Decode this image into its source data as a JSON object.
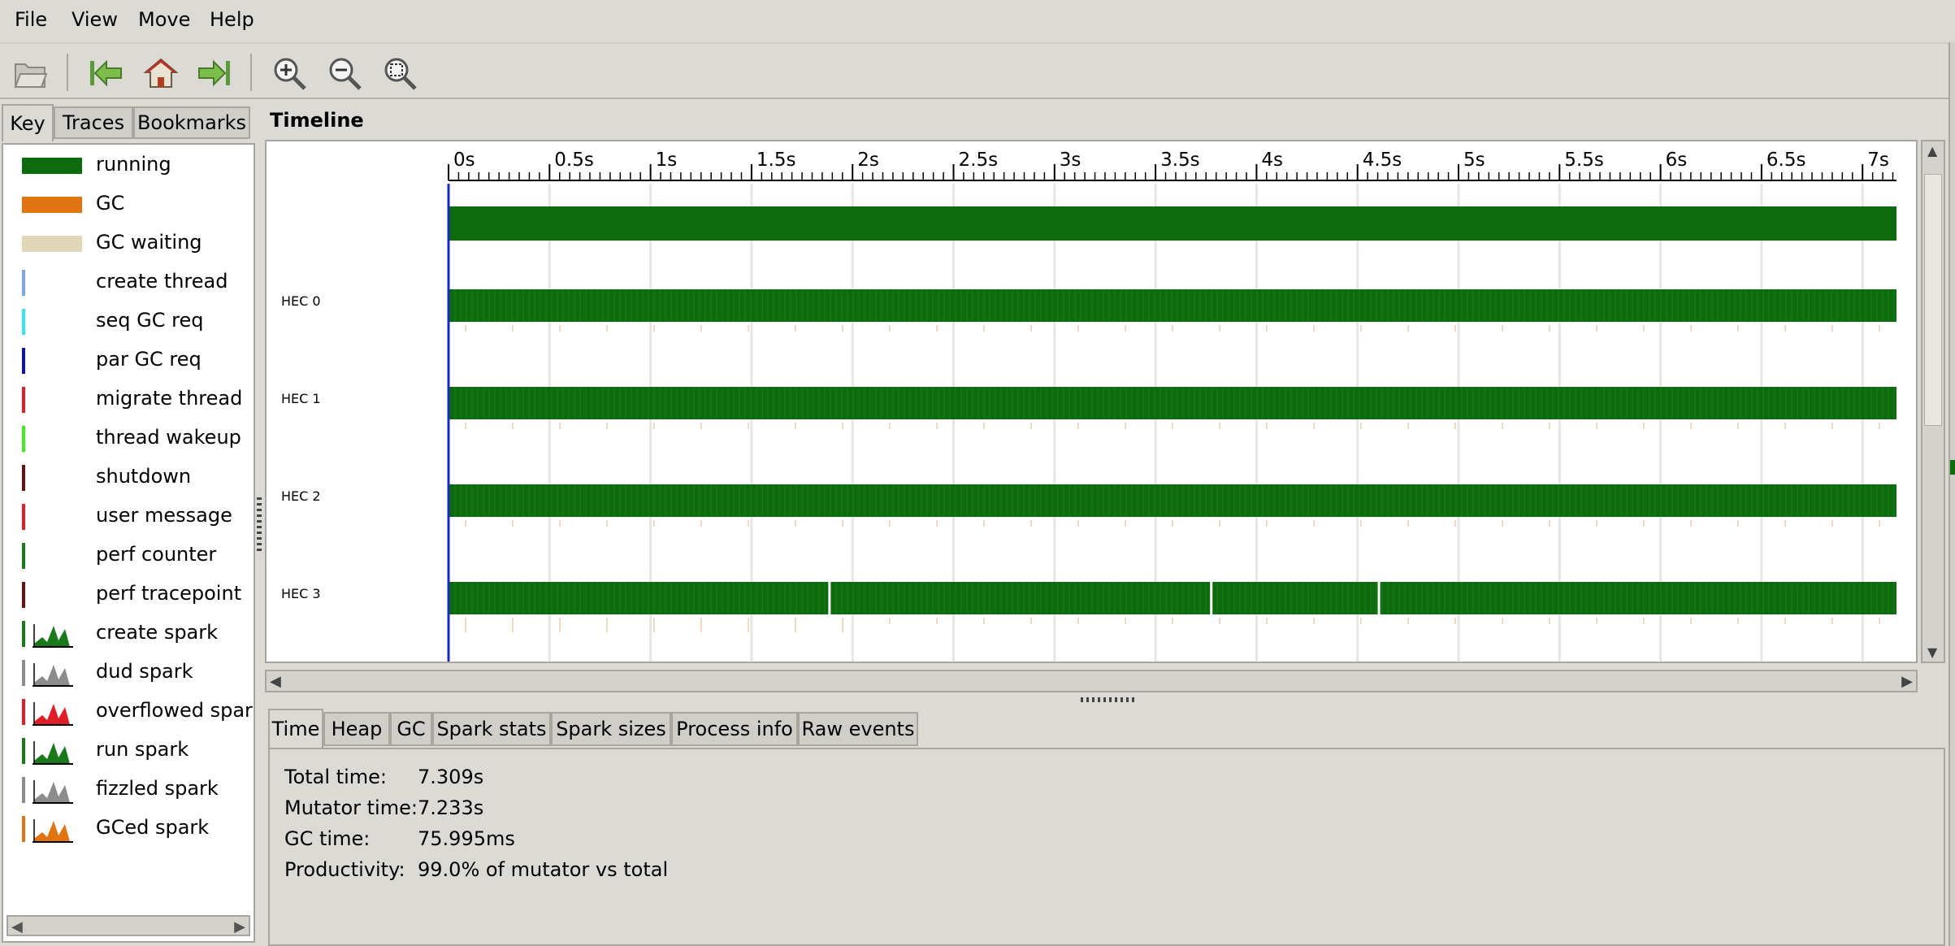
{
  "menu": [
    "File",
    "View",
    "Move",
    "Help"
  ],
  "toolbar": {
    "icons": [
      "open-icon",
      "jump-start-icon",
      "home-icon",
      "jump-end-icon",
      "zoom-in-icon",
      "zoom-out-icon",
      "zoom-fit-icon"
    ]
  },
  "left_tabs": [
    "Key",
    "Traces",
    "Bookmarks"
  ],
  "key": [
    {
      "label": "running",
      "color": "#0c6b0c",
      "kind": "bar"
    },
    {
      "label": "GC",
      "color": "#e07410",
      "kind": "bar"
    },
    {
      "label": "GC waiting",
      "color": "#e0d6b8",
      "kind": "bar"
    },
    {
      "label": "create thread",
      "color": "#7aa6f0",
      "kind": "line"
    },
    {
      "label": "seq GC req",
      "color": "#35e8f0",
      "kind": "line"
    },
    {
      "label": "par GC req",
      "color": "#0a13b8",
      "kind": "line"
    },
    {
      "label": "migrate thread",
      "color": "#e01e28",
      "kind": "line"
    },
    {
      "label": "thread wakeup",
      "color": "#3cf020",
      "kind": "line"
    },
    {
      "label": "shutdown",
      "color": "#6b1010",
      "kind": "line"
    },
    {
      "label": "user message",
      "color": "#e01e28",
      "kind": "line"
    },
    {
      "label": "perf counter",
      "color": "#1a7a1a",
      "kind": "line"
    },
    {
      "label": "perf tracepoint",
      "color": "#6b1010",
      "kind": "line"
    },
    {
      "label": "create spark",
      "color": "#1a7a1a",
      "kind": "spark"
    },
    {
      "label": "dud spark",
      "color": "#8c8c8c",
      "kind": "spark"
    },
    {
      "label": "overflowed spark",
      "color": "#e01e28",
      "kind": "spark"
    },
    {
      "label": "run spark",
      "color": "#1a7a1a",
      "kind": "spark"
    },
    {
      "label": "fizzled spark",
      "color": "#8c8c8c",
      "kind": "spark"
    },
    {
      "label": "GCed spark",
      "color": "#e07410",
      "kind": "spark"
    }
  ],
  "timeline": {
    "title": "Timeline",
    "ticks": [
      "0s",
      "0.5s",
      "1s",
      "1.5s",
      "2s",
      "2.5s",
      "3s",
      "3.5s",
      "4s",
      "4.5s",
      "5s",
      "5.5s",
      "6s",
      "6.5s",
      "7s"
    ],
    "hecs": [
      "HEC 0",
      "HEC 1",
      "HEC 2",
      "HEC 3"
    ],
    "hec3_gaps_s": [
      1.88,
      3.77,
      4.6
    ],
    "end_s": 7.309,
    "running_color": "#0c6b0c"
  },
  "bottom_tabs": [
    "Time",
    "Heap",
    "GC",
    "Spark stats",
    "Spark sizes",
    "Process info",
    "Raw events"
  ],
  "stats": [
    {
      "label": "Total time:",
      "value": "7.309s"
    },
    {
      "label": "Mutator time:",
      "value": "7.233s"
    },
    {
      "label": "GC time:",
      "value": "75.995ms"
    },
    {
      "label": "Productivity:",
      "value": "99.0% of mutator vs total"
    }
  ]
}
